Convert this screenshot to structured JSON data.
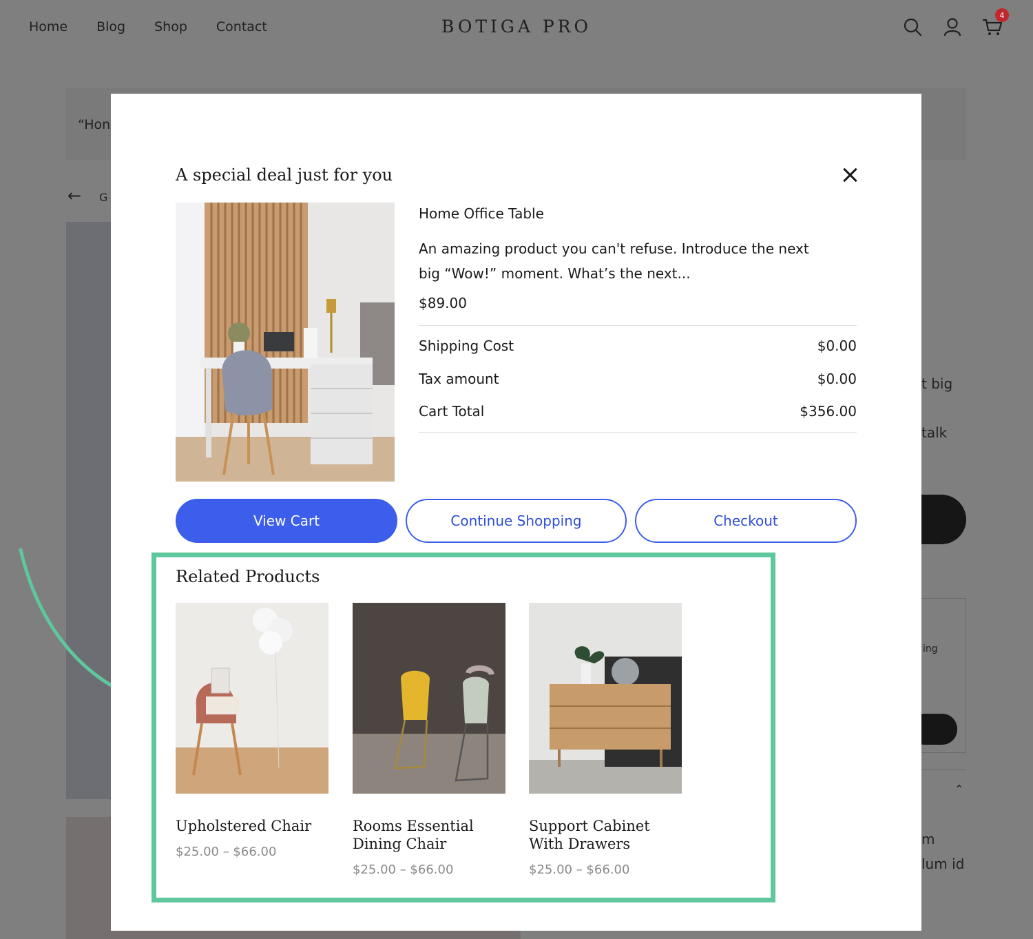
{
  "header": {
    "nav": [
      "Home",
      "Blog",
      "Shop",
      "Contact"
    ],
    "brand": "BOTIGA PRO",
    "cart_count": "4",
    "icons": [
      "search-icon",
      "user-icon",
      "cart-icon"
    ]
  },
  "background": {
    "breadcrumb": "“Hon",
    "back_text": "G",
    "right_text_1": "t big",
    "right_text_2": "talk",
    "right_text_3": "ing",
    "right_text_4": "m",
    "right_text_5": "lum id"
  },
  "modal": {
    "title": "A special deal just for you",
    "product": {
      "name": "Home Office Table",
      "description": "An amazing product you can't refuse. Introduce the next big “Wow!” moment. What’s the next...",
      "price": "$89.00"
    },
    "summary": [
      {
        "label": "Shipping Cost",
        "value": "$0.00"
      },
      {
        "label": "Tax amount",
        "value": "$0.00"
      },
      {
        "label": "Cart Total",
        "value": "$356.00"
      }
    ],
    "buttons": {
      "view_cart": "View Cart",
      "continue_shopping": "Continue Shopping",
      "checkout": "Checkout"
    },
    "related": {
      "title": "Related Products",
      "items": [
        {
          "name": "Upholstered Chair",
          "price": "$25.00 – $66.00"
        },
        {
          "name": "Rooms Essential Dining Chair",
          "price": "$25.00 – $66.00"
        },
        {
          "name": "Support Cabinet With Drawers",
          "price": "$25.00 – $66.00"
        }
      ]
    }
  },
  "colors": {
    "overlay": "#7f7f7f",
    "primary": "#3c5eea",
    "highlight": "#5fc79d",
    "badge": "#c0282d"
  }
}
